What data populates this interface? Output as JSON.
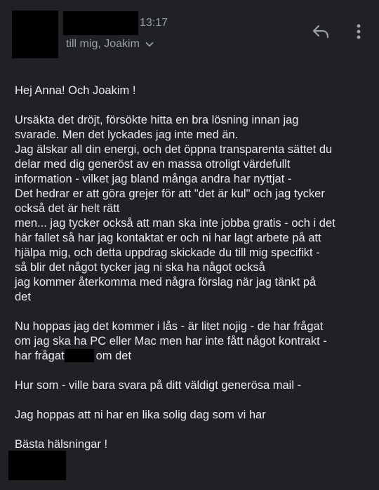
{
  "header": {
    "time": "13:17",
    "recipients": "till mig, Joakim",
    "icons": {
      "chevron": "chevron-down-icon",
      "reply": "reply-icon",
      "more": "more-vert-icon"
    }
  },
  "message": {
    "greeting": "Hej Anna! Och Joakim !",
    "p1": [
      "Ursäkta det dröjt, försökte hitta en bra lösning innan jag",
      "svarade. Men det lyckades jag inte med än.",
      "Jag älskar all din energi, och det öppna transparenta sättet du",
      "delar med dig generöst av en massa otroligt värdefullt",
      "information - vilket jag bland många andra har nyttjat -",
      "Det hedrar er att göra grejer för att \"det är kul\" och jag tycker",
      "också det är helt rätt",
      "men... jag tycker också att man ska inte jobba gratis - och i det",
      "här fallet så har jag kontaktat er och ni har lagt arbete på att",
      "hjälpa mig, och detta uppdrag skickade du till mig specifikt -",
      "så blir det något tycker jag ni ska ha något också",
      "jag kommer återkomma med några förslag när jag tänkt på",
      "det"
    ],
    "p2": [
      "Nu hoppas jag det kommer i lås - är litet nojig - de har frågat",
      "om jag ska ha PC eller Mac men har inte fått något kontrakt -"
    ],
    "p2_last_before": "har frågat",
    "p2_last_after": "om det",
    "p3": "Hur som - ville bara svara på ditt väldigt generösa mail -",
    "p4": "Jag hoppas att ni har en lika solig dag som vi har",
    "closing": "Bästa hälsningar !"
  },
  "colors": {
    "background": "#202124",
    "text": "#e8eaed",
    "secondary": "#9aa0a6",
    "redaction": "#000000"
  }
}
